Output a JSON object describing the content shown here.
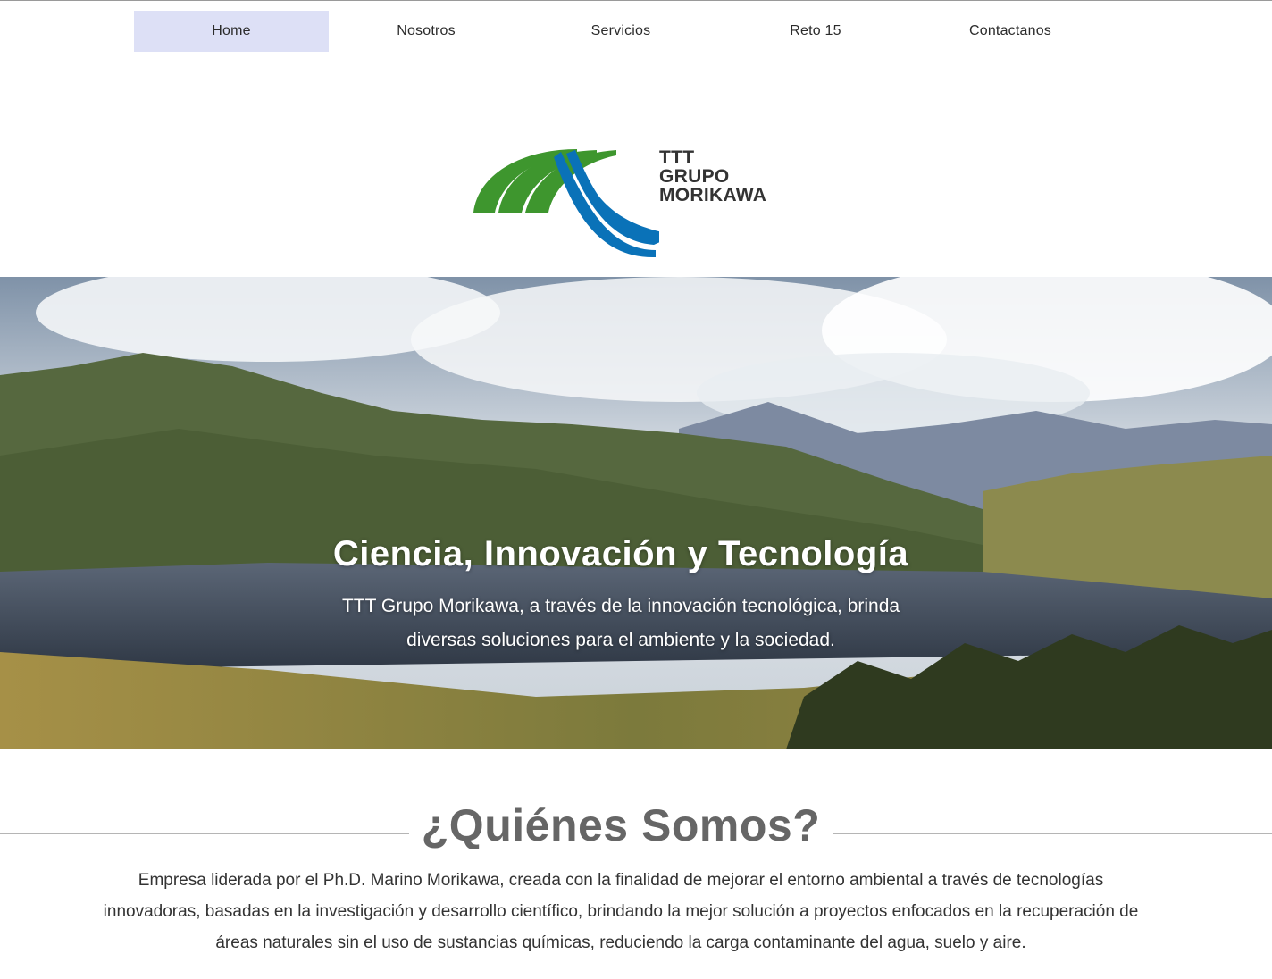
{
  "nav": {
    "items": [
      {
        "label": "Home",
        "active": true
      },
      {
        "label": "Nosotros",
        "active": false
      },
      {
        "label": "Servicios",
        "active": false
      },
      {
        "label": "Reto 15",
        "active": false
      },
      {
        "label": "Contactanos",
        "active": false
      }
    ],
    "active_bg": "#dde0f6"
  },
  "logo": {
    "line1": "TTT",
    "line2": "GRUPO",
    "line3": "MORIKAWA",
    "green": "#3e962e",
    "blue": "#0a72b8"
  },
  "hero": {
    "title": "Ciencia, Innovación y Tecnología",
    "subtitle": "TTT Grupo Morikawa, a través de la innovación tecnológica, brinda diversas soluciones para el ambiente y la sociedad."
  },
  "about": {
    "heading": "¿Quiénes Somos?",
    "text": "Empresa liderada por el Ph.D. Marino Morikawa, creada con la finalidad de mejorar el entorno ambiental a través de tecnologías innovadoras, basadas en la investigación y desarrollo científico, brindando la mejor solución a proyectos enfocados en la recuperación de áreas naturales sin el uso de sustancias químicas, reduciendo la carga contaminante del agua, suelo y aire."
  }
}
